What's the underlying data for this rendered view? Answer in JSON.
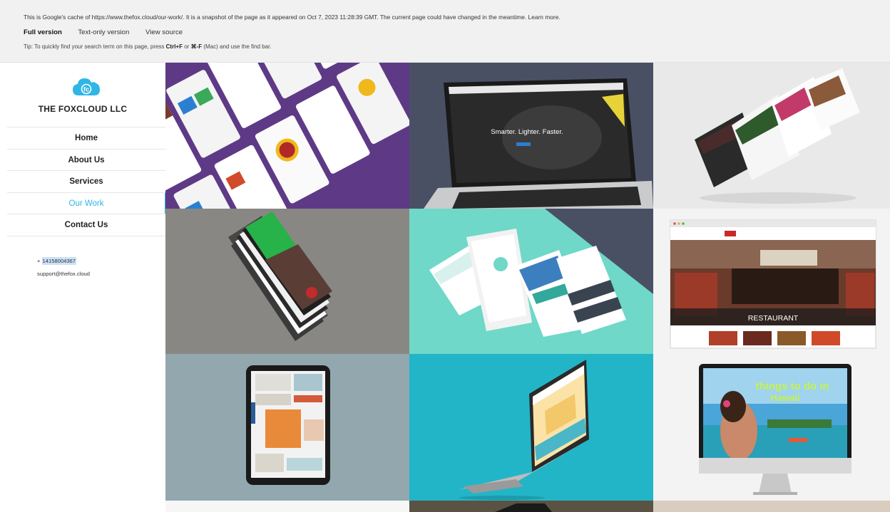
{
  "cache_banner": {
    "notice": "This is Google's cache of https://www.thefox.cloud/our-work/. It is a snapshot of the page as it appeared on Oct 7, 2023 11:28:39 GMT. The current page could have changed in the meantime. Learn more.",
    "links": [
      "Full version",
      "Text-only version",
      "View source"
    ],
    "tip_prefix": "Tip: To quickly find your search term on this page, press ",
    "tip_keys_1": "Ctrl+F",
    "tip_or": " or ",
    "tip_keys_2": "⌘-F",
    "tip_suffix": " (Mac) and use the find bar."
  },
  "sidebar": {
    "logo_letters": "fc",
    "brand": "THE FOXCLOUD LLC",
    "nav": [
      {
        "label": "Home",
        "active": false
      },
      {
        "label": "About Us",
        "active": false
      },
      {
        "label": "Services",
        "active": false
      },
      {
        "label": "Our Work",
        "active": true
      },
      {
        "label": "Contact Us",
        "active": false
      }
    ],
    "phone_prefix": "+ ",
    "phone": "14158004367",
    "email": "support@thefox.cloud"
  },
  "portfolio": {
    "laptop_headline": "Smarter. Lighter. Faster.",
    "restaurant_label": "RESTAURANT",
    "hawaii_title_1": "things to do in",
    "hawaii_title_2": "Hawaii"
  },
  "colors": {
    "accent": "#2fb6e6",
    "banner_bg": "#f1f1f1",
    "tile_purple": "#5e3a86",
    "tile_slate": "#4a5064",
    "tile_light": "#e9e9e9",
    "tile_mint": "#6fd8c8",
    "tile_gray_blue": "#93a7ae",
    "tile_cyan": "#22b5c7"
  }
}
